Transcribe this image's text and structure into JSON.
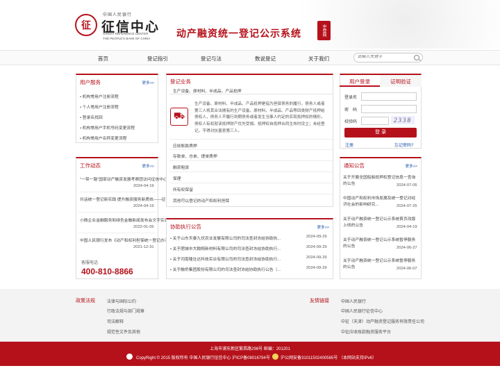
{
  "header": {
    "bank_name": "中国人民银行",
    "center_name": "征信中心",
    "en_line1": "CREDIT REFERENCE CENTER",
    "en_line2": "THE PEOPLE'S BANK OF CHINA",
    "system_title": "动产融资统一登记公示系统",
    "stamp": "中登网",
    "seal_glyph": "征"
  },
  "nav": {
    "items": [
      "首页",
      "登记指引",
      "登记与法",
      "数说登记",
      "关于我们"
    ],
    "search_placeholder": "请输入关键字"
  },
  "user_service": {
    "title": "用户服务",
    "more": "更多>>",
    "items": [
      "机构常用户注册流程",
      "个人常用户注册流程",
      "登录名找回",
      "机构常用户手机号码变更流程",
      "机构常用户名称变更流程"
    ]
  },
  "work_news": {
    "title": "工作动态",
    "more": "更多>>",
    "items": [
      {
        "title": "\"一带一路\"国家动产融资发展考察团访问征信中心",
        "date": "2024-04-19"
      },
      {
        "title": "共话统一登记新实践 提升融资服务新质效——征信中心...",
        "date": "2024-04-19"
      },
      {
        "title": "小微企业金融服务和绿色金融新闻发布会文字实录",
        "date": "2022-01-05"
      },
      {
        "title": "中国人民银行发布《动产和权利担保统一登记办法》",
        "date": "2021-12-31"
      }
    ]
  },
  "hotline": {
    "label": "客服电话",
    "number": "400-810-8866"
  },
  "registration": {
    "title": "登记业务",
    "subtitle": "生产设备、原材料、半成品、产品抵押",
    "icon_glyph": "⛟",
    "description": "生产设备、原材料、半成品、产品抵押是指为担保债务的履行，债务人或者第三人将其合法拥有的生产设备、原材料、半成品、产品等四类财产抵押给债权人，债务人不履行到期债务或者发生当事人约定的实现抵押权的情形，债权人有权就该抵押财产优先受偿。抵押权自抵押合同生效时设立；未经登记，不得对抗善意第三人。",
    "items": [
      "应收账款质押",
      "存款单、仓单、提单质押",
      "融资租赁",
      "保理",
      "所有权保留",
      "其他可以登记的动产和权利担保"
    ]
  },
  "assist": {
    "title": "协助执行公告",
    "more": "更多>>",
    "items": [
      {
        "title": "关于山东天泰九优农业发展有限公司的司法查封冻结协助执...",
        "date": "2024-09-29"
      },
      {
        "title": "关于肥城市大翰翔新材料有限公司的司法查封冻结协助执行...",
        "date": "2024-09-29"
      },
      {
        "title": "关于河南隆壮达科技实业有限公司的司法查封冻结协助执行...",
        "date": "2024-09-29"
      },
      {
        "title": "关于融侨集团股份有限公司的司法查封冻结协助执行公告（...",
        "date": "2024-09-29"
      }
    ]
  },
  "login": {
    "tab_login": "用户登录",
    "tab_cert": "证明验证",
    "username_label": "登录名",
    "password_label": "密　码",
    "captcha_label": "校验码",
    "captcha_value": "2338",
    "login_button": "登 录",
    "register": "注册",
    "forgot": "忘记密码?"
  },
  "notices": {
    "title": "通知公告",
    "more": "更多>>",
    "items": [
      {
        "title": "关于开展全国船舶抵押权登记信息一查询的公告",
        "date": "2024-07-05"
      },
      {
        "title": "中国动产和权利市场发展及统一登记对经济社会的影响研究...",
        "date": "2024-07-25"
      },
      {
        "title": "关于动产融资统一登记公示系统首页改版上线的公告",
        "date": "2024-04-19"
      },
      {
        "title": "关于动产融资统一登记公示系统暂停服务的公告",
        "date": "2024-06-27"
      },
      {
        "title": "关于动产融资统一登记公示系统暂停服务的公告",
        "date": "2024-06-07"
      }
    ]
  },
  "footer_links": {
    "policy_title": "政策法规",
    "policy_items": [
      "法律与国际公约",
      "行政法规与部门规章",
      "司法解释",
      "规范性文件及其他"
    ],
    "friend_title": "友情链接",
    "friend_items": [
      "中国人民银行",
      "中国人民银行征信中心",
      "中征（天津）动产融资登记服务有限责任公司",
      "中征应收账款融资服务平台"
    ]
  },
  "footer": {
    "address": "上海市浦东新区繁昌路298号  邮编：201201",
    "copyright": "CopyRight © 2015 版权所有 中国人民银行征信中心 沪ICP备08016794号",
    "police": "沪公网安备31011502400565号  （本网站支持IPv6）"
  }
}
